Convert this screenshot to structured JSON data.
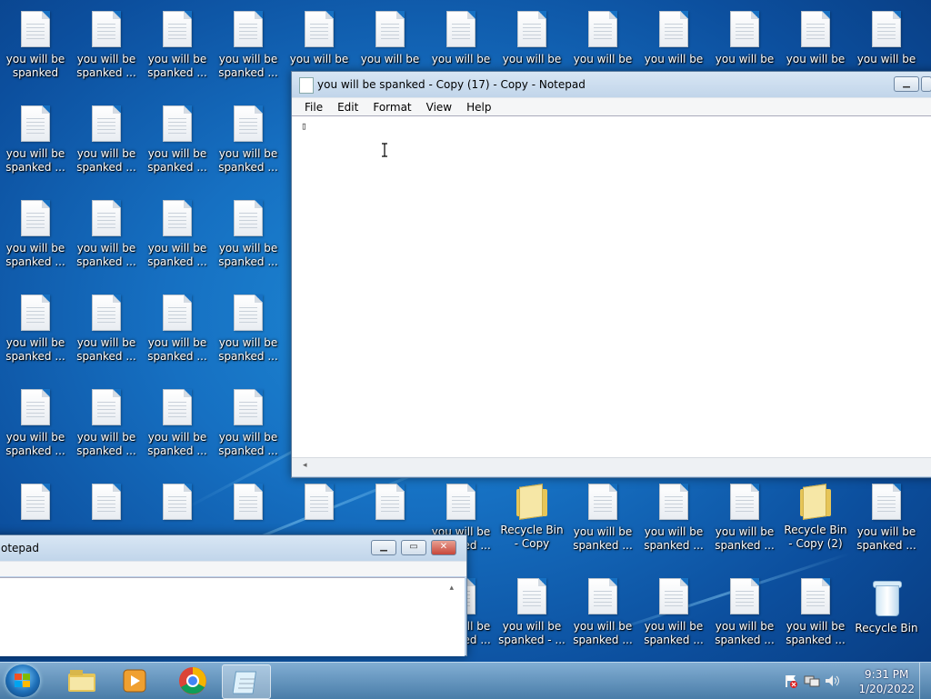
{
  "desktop": {
    "file_label_full": "you will be spanked",
    "file_label_trunc": "you will be spanked ...",
    "file_label_line1": "you will be",
    "file_label_dash": "you will be spanked - ...",
    "recycle_copy": "Recycle Bin - Copy",
    "recycle_copy2": "Recycle Bin - Copy (2)",
    "recycle_bin": "Recycle Bin"
  },
  "notepad_main": {
    "title": "you will be spanked - Copy (17) - Copy - Notepad",
    "menu": [
      "File",
      "Edit",
      "Format",
      "View",
      "Help"
    ],
    "content": "▯"
  },
  "notepad_back": {
    "title": "otepad"
  },
  "taskbar": {
    "time": "9:31 PM",
    "date": "1/20/2022",
    "pinned": [
      "start-orb",
      "explorer-icon",
      "media-player-icon",
      "chrome-icon",
      "notepad-icon"
    ]
  },
  "colors": {
    "desktop_blue": "#1670c2",
    "window_frame": "#bcd2ea",
    "close_red": "#c7463a"
  }
}
